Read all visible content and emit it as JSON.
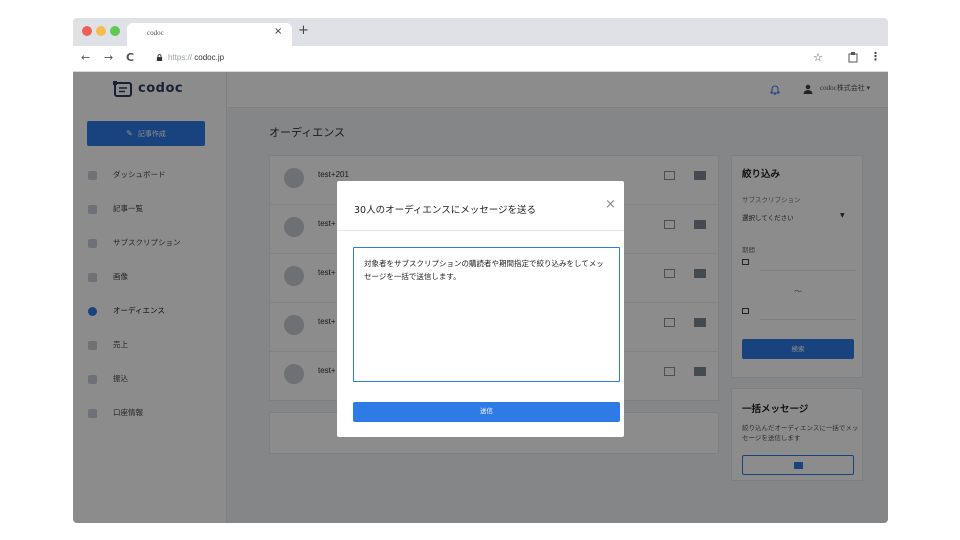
{
  "browser": {
    "tab_title": "codoc",
    "tab_close": "×",
    "new_tab": "+",
    "back": "←",
    "forward": "→",
    "reload": "C",
    "url_scheme": "https://",
    "url_host": "codoc.jp",
    "bookmark": "☆",
    "menu": "⋮"
  },
  "app": {
    "logo_text": "codoc",
    "user_name": "codoc株式会社",
    "compose_label": "記事作成",
    "menu": [
      {
        "label": "ダッシュボード"
      },
      {
        "label": "記事一覧"
      },
      {
        "label": "サブスクリプション"
      },
      {
        "label": "画像"
      },
      {
        "label": "オーディエンス"
      },
      {
        "label": "売上"
      },
      {
        "label": "振込"
      },
      {
        "label": "口座情報"
      }
    ],
    "page_title": "オーディエンス",
    "rows": [
      {
        "name": "test+201"
      },
      {
        "name": "test+"
      },
      {
        "name": "test+"
      },
      {
        "name": "test+"
      },
      {
        "name": "test+"
      }
    ],
    "filter": {
      "title": "絞り込み",
      "subscription_label": "サブスクリプション",
      "select_value": "選択してください",
      "period_label": "期間",
      "tilde": "〜",
      "search_button": "検索"
    },
    "bulk": {
      "title": "一括メッセージ",
      "description": "絞り込んだオーディエンスに一括でメッセージを送信します"
    }
  },
  "modal": {
    "title": "30人のオーディエンスにメッセージを送る",
    "close": "×",
    "message": "対象者をサブスクリプションの購読者や期間指定で絞り込みをしてメッセージを一括で送信します。",
    "send_label": "送信"
  },
  "colors": {
    "accent": "#2f7be5",
    "overlay": "rgba(0,0,0,0.45)"
  }
}
